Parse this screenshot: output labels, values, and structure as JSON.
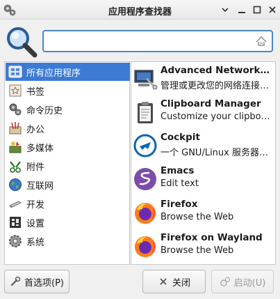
{
  "window": {
    "title": "应用程序查找器",
    "icons": [
      "gears-icon",
      "window-menu-icon",
      "minimize-icon",
      "maximize-icon",
      "close-icon"
    ]
  },
  "search": {
    "value": "",
    "placeholder": "",
    "clear_icon": "clear-text-icon"
  },
  "categories": [
    {
      "label": "所有应用程序",
      "icon": "all-apps-icon",
      "selected": true
    },
    {
      "label": "书签",
      "icon": "bookmarks-icon",
      "selected": false
    },
    {
      "label": "命令历史",
      "icon": "command-history-icon",
      "selected": false
    },
    {
      "label": "办公",
      "icon": "office-icon",
      "selected": false
    },
    {
      "label": "多媒体",
      "icon": "multimedia-icon",
      "selected": false
    },
    {
      "label": "附件",
      "icon": "accessories-icon",
      "selected": false
    },
    {
      "label": "互联网",
      "icon": "internet-icon",
      "selected": false
    },
    {
      "label": "开发",
      "icon": "development-icon",
      "selected": false
    },
    {
      "label": "设置",
      "icon": "settings-icon",
      "selected": false
    },
    {
      "label": "系统",
      "icon": "system-icon",
      "selected": false
    }
  ],
  "apps": [
    {
      "name": "Advanced Network Configuration",
      "desc": "管理或更改您的网络连接设置",
      "icon": "network-icon"
    },
    {
      "name": "Clipboard Manager",
      "desc": "Customize your clipboard",
      "icon": "clipboard-icon"
    },
    {
      "name": "Cockpit",
      "desc": "一个 GNU/Linux 服务器管理界面",
      "icon": "cockpit-icon"
    },
    {
      "name": "Emacs",
      "desc": "Edit text",
      "icon": "emacs-icon"
    },
    {
      "name": "Firefox",
      "desc": "Browse the Web",
      "icon": "firefox-icon"
    },
    {
      "name": "Firefox on Wayland",
      "desc": "Browse the Web",
      "icon": "firefox-icon"
    }
  ],
  "buttons": {
    "prefs": {
      "label": "首选项(P)",
      "icon": "preferences-icon"
    },
    "close": {
      "label": "关闭",
      "icon": "close-x-icon"
    },
    "launch": {
      "label": "启动(U)",
      "icon": "launch-icon",
      "disabled": true
    }
  },
  "colors": {
    "selection": "#3d7ad4",
    "search_border": "#4a86c8"
  }
}
